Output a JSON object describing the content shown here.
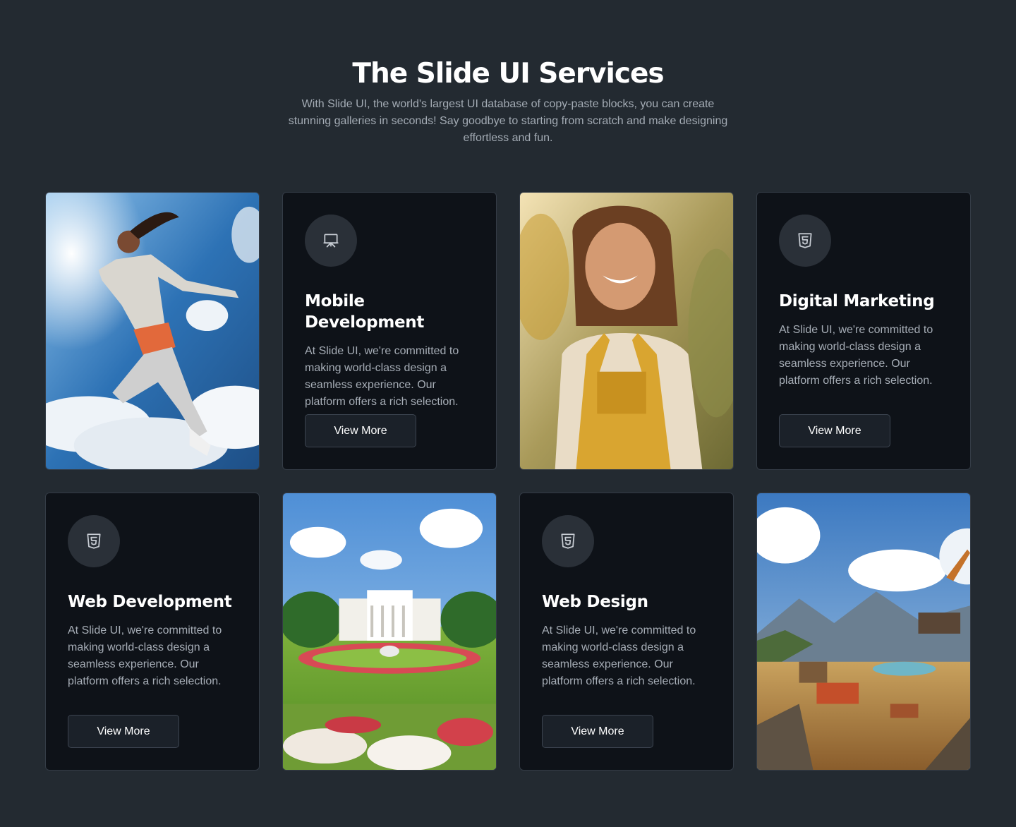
{
  "header": {
    "title": "The Slide UI Services",
    "subtitle": "With Slide UI, the world's largest UI database of copy-paste blocks, you can create stunning galleries in seconds! Say goodbye to starting from scratch and make designing effortless and fun."
  },
  "cards": [
    {
      "kind": "image",
      "image": "woman-jumping-in-sky-photo"
    },
    {
      "kind": "text",
      "icon": "presentation-icon",
      "title": "Mobile Development",
      "description": "At Slide UI, we're committed to making world-class design a seamless experience. Our platform offers a rich selection.",
      "button": "View More"
    },
    {
      "kind": "image",
      "image": "smiling-woman-in-field-photo"
    },
    {
      "kind": "text",
      "icon": "html5-icon",
      "title": "Digital Marketing",
      "description": "At Slide UI, we're committed to making world-class design a seamless experience. Our platform offers a rich selection.",
      "button": "View More"
    },
    {
      "kind": "text",
      "icon": "html5-icon",
      "title": "Web Development",
      "description": "At Slide UI, we're committed to making world-class design a seamless experience. Our platform offers a rich selection.",
      "button": "View More"
    },
    {
      "kind": "image",
      "image": "white-house-garden-photo"
    },
    {
      "kind": "text",
      "icon": "html5-icon",
      "title": "Web Design",
      "description": "At Slide UI, we're committed to making world-class design a seamless experience. Our platform offers a rich selection.",
      "button": "View More"
    },
    {
      "kind": "image",
      "image": "mining-landscape-photo"
    }
  ],
  "colors": {
    "page_background": "#232a31",
    "card_background": "#0e1218",
    "icon_circle": "#2a3038",
    "body_text": "#a6adb6"
  }
}
